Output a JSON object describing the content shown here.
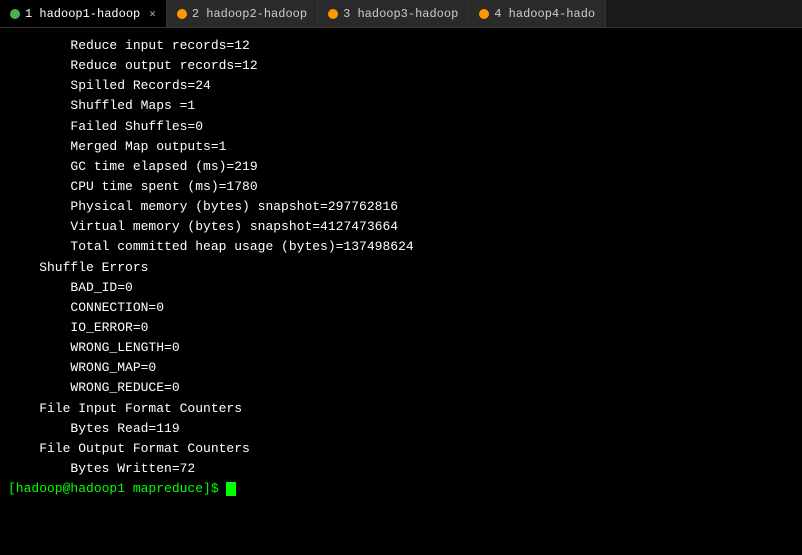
{
  "tabs": [
    {
      "id": 1,
      "label": "1 hadoop1-hadoop",
      "indicator_color": "#4caf50",
      "active": true,
      "show_close": true
    },
    {
      "id": 2,
      "label": "2 hadoop2-hadoop",
      "indicator_color": "#ff9800",
      "active": false,
      "show_close": false
    },
    {
      "id": 3,
      "label": "3 hadoop3-hadoop",
      "indicator_color": "#ff9800",
      "active": false,
      "show_close": false
    },
    {
      "id": 4,
      "label": "4 hadoop4-hado",
      "indicator_color": "#ff9800",
      "active": false,
      "show_close": false
    }
  ],
  "terminal": {
    "lines": [
      "        Reduce input records=12",
      "        Reduce output records=12",
      "        Spilled Records=24",
      "        Shuffled Maps =1",
      "        Failed Shuffles=0",
      "        Merged Map outputs=1",
      "        GC time elapsed (ms)=219",
      "        CPU time spent (ms)=1780",
      "        Physical memory (bytes) snapshot=297762816",
      "        Virtual memory (bytes) snapshot=4127473664",
      "        Total committed heap usage (bytes)=137498624",
      "    Shuffle Errors",
      "        BAD_ID=0",
      "        CONNECTION=0",
      "        IO_ERROR=0",
      "        WRONG_LENGTH=0",
      "        WRONG_MAP=0",
      "        WRONG_REDUCE=0",
      "    File Input Format Counters",
      "        Bytes Read=119",
      "    File Output Format Counters",
      "        Bytes Written=72"
    ],
    "prompt": "[hadoop@hadoop1 mapreduce]$ "
  }
}
